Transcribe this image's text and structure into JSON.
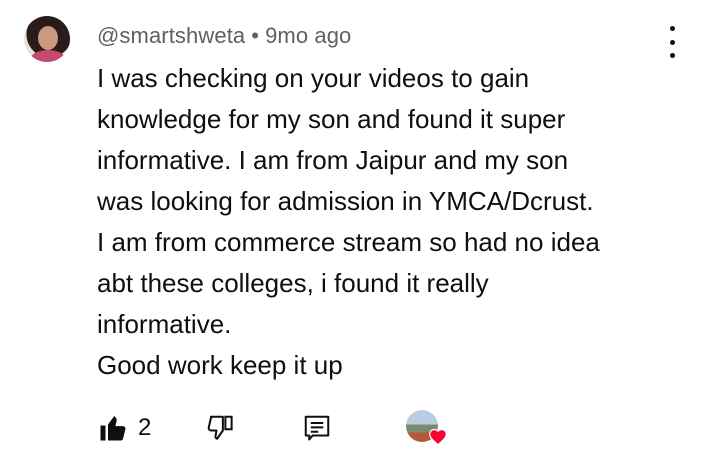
{
  "comment": {
    "author": "@smartshweta",
    "separator": "•",
    "time": "9mo ago",
    "lines": [
      "I was checking on your videos to gain",
      "knowledge for my son and found it super",
      "informative. I am from Jaipur and my son",
      "was looking for admission in YMCA/Dcrust.",
      "I am from commerce stream so had no idea",
      "abt these colleges, i found it really",
      "informative.",
      "Good work keep it up"
    ]
  },
  "actions": {
    "like_count": "2",
    "icons": [
      "thumbs-up-icon",
      "thumbs-down-icon",
      "reply-icon",
      "creator-heart-icon"
    ]
  },
  "colors": {
    "text": "#0f0f0f",
    "meta": "#606060",
    "heart": "#ff0033"
  }
}
